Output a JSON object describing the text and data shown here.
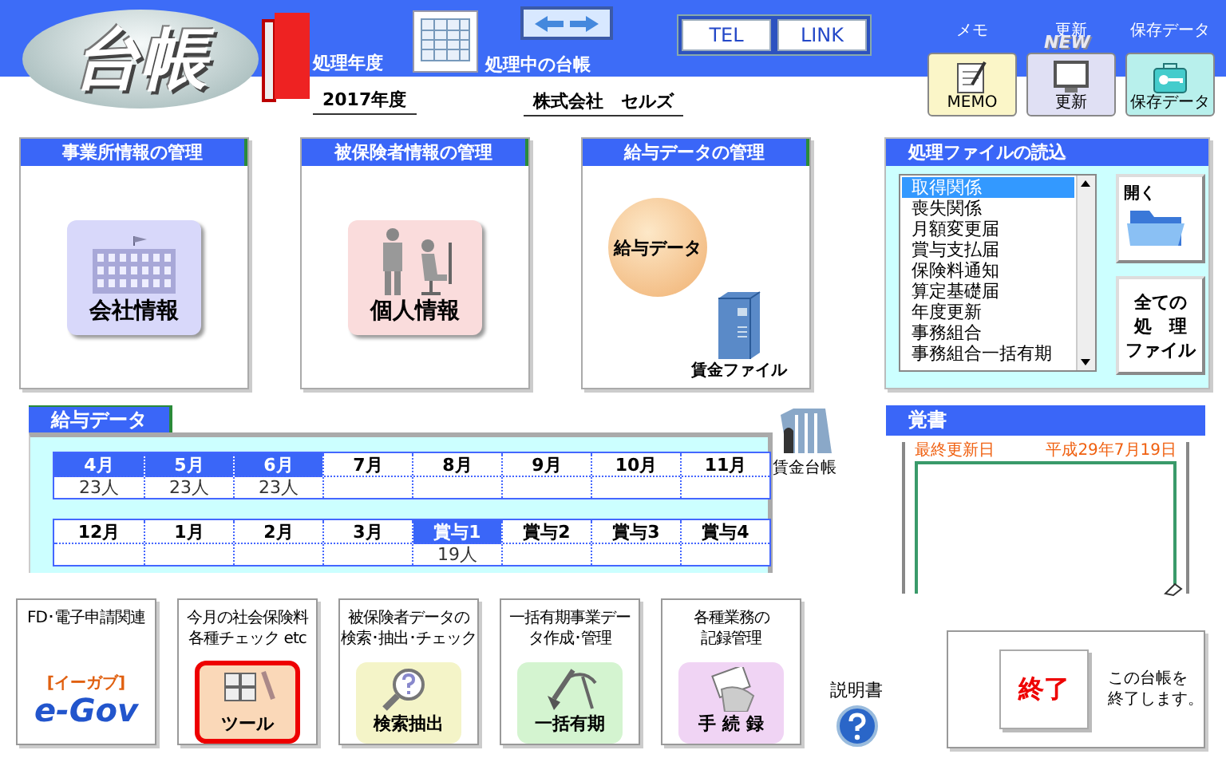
{
  "header": {
    "logo": "台帳",
    "fiscal_year": {
      "label": "処理年度",
      "value": "2017年度"
    },
    "ledger": {
      "label": "処理中の台帳",
      "value": "株式会社　セルズ"
    },
    "links": [
      "TEL",
      "LINK"
    ],
    "tools": [
      {
        "kind": "memo",
        "label": "メモ",
        "caption": "MEMO"
      },
      {
        "kind": "update",
        "label": "更新",
        "caption": "更新",
        "badge": "NEW"
      },
      {
        "kind": "save",
        "label": "保存データ",
        "caption": "保存データ"
      }
    ]
  },
  "panels": [
    {
      "kind": "company",
      "title": "事業所情報の管理",
      "button": "会社情報"
    },
    {
      "kind": "person",
      "title": "被保険者情報の管理",
      "button": "個人情報"
    },
    {
      "kind": "payroll",
      "title": "給与データの管理",
      "button": "給与データ",
      "file": "賃金ファイル"
    }
  ],
  "file_loader": {
    "title": "処理ファイルの読込",
    "items": [
      {
        "label": "取得関係",
        "selected": true
      },
      {
        "label": "喪失関係",
        "selected": false
      },
      {
        "label": "月額変更届",
        "selected": false
      },
      {
        "label": "賞与支払届",
        "selected": false
      },
      {
        "label": "保険料通知",
        "selected": false
      },
      {
        "label": "算定基礎届",
        "selected": false
      },
      {
        "label": "年度更新",
        "selected": false
      },
      {
        "label": "事務組合",
        "selected": false
      },
      {
        "label": "事務組合一括有期",
        "selected": false
      }
    ],
    "open_button": "開く",
    "all_button": [
      "全ての",
      "処　理",
      "ファイル"
    ]
  },
  "salary": {
    "tab": "給与データ",
    "rows": [
      [
        {
          "month": "4月",
          "entered": true,
          "count": "23人"
        },
        {
          "month": "5月",
          "entered": true,
          "count": "23人"
        },
        {
          "month": "6月",
          "entered": true,
          "count": "23人"
        },
        {
          "month": "7月",
          "entered": false
        },
        {
          "month": "8月",
          "entered": false
        },
        {
          "month": "9月",
          "entered": false
        },
        {
          "month": "10月",
          "entered": false
        },
        {
          "month": "11月",
          "entered": false
        }
      ],
      [
        {
          "month": "12月",
          "entered": false
        },
        {
          "month": "1月",
          "entered": false
        },
        {
          "month": "2月",
          "entered": false
        },
        {
          "month": "3月",
          "entered": false
        },
        {
          "month": "賞与1",
          "entered": true,
          "count": "19人"
        },
        {
          "month": "賞与2",
          "entered": false
        },
        {
          "month": "賞与3",
          "entered": false
        },
        {
          "month": "賞与4",
          "entered": false
        }
      ]
    ],
    "ledger_button": "賃金台帳"
  },
  "memo": {
    "title": "覚書",
    "updated_label": "最終更新日",
    "updated_value": "平成29年7月19日"
  },
  "bottom_tools": [
    {
      "kind": "egov",
      "caption": [
        "FD･電子申請関連"
      ],
      "button": "e-Gov",
      "sub": "[イーガブ]",
      "selected": false
    },
    {
      "kind": "tool",
      "caption": [
        "今月の社会保険料",
        "各種チェック etc"
      ],
      "button": "ツール",
      "selected": true
    },
    {
      "kind": "search",
      "caption": [
        "被保険者データの",
        "検索･抽出･チェック"
      ],
      "button": "検索抽出",
      "selected": false
    },
    {
      "kind": "dig",
      "caption": [
        "一括有期事業デー",
        "タ作成･管理"
      ],
      "button": "一括有期",
      "selected": false
    },
    {
      "kind": "record",
      "caption": [
        "各種業務の",
        "記録管理"
      ],
      "button": "手 続 録",
      "selected": false
    }
  ],
  "manual": "説明書",
  "exit": {
    "button": "終了",
    "note": [
      "この台帳を",
      "終了します。"
    ]
  }
}
